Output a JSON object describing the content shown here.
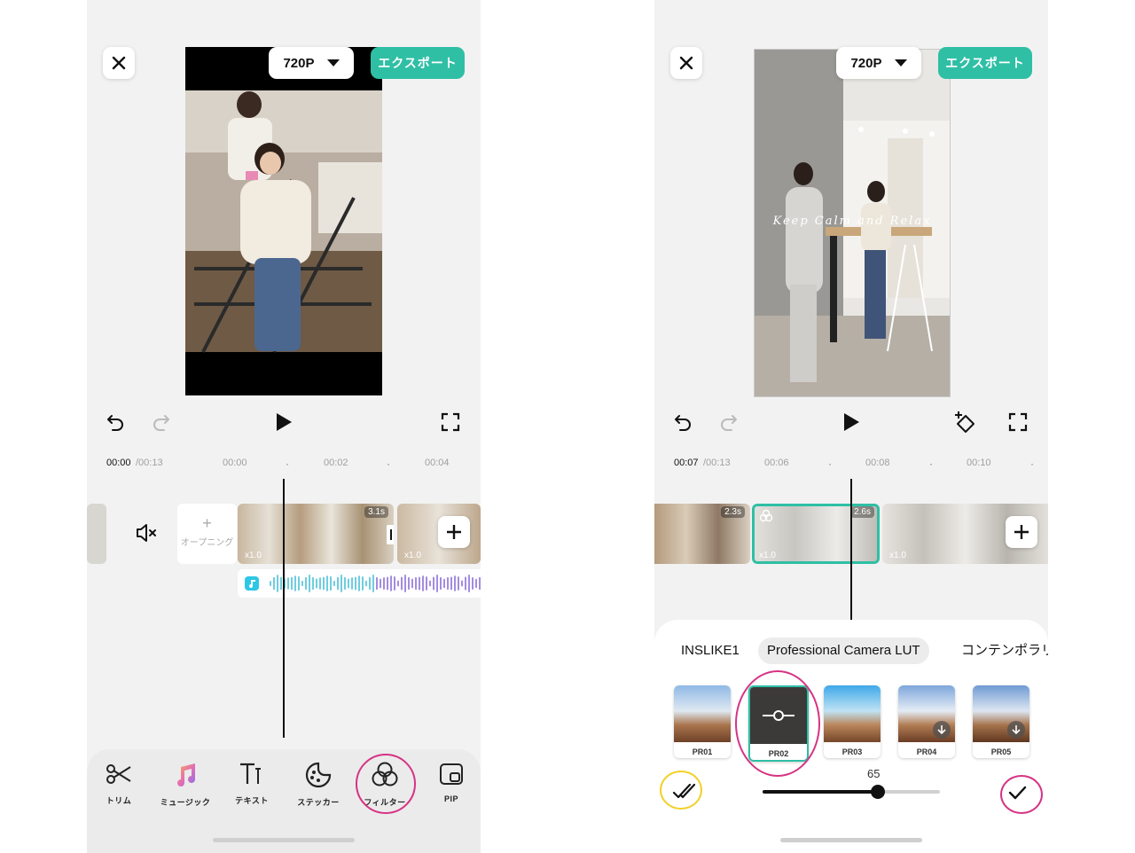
{
  "common": {
    "resolution": "720P",
    "export_label": "エクスポート",
    "accent_color": "#2fbfa5",
    "highlight_color": "#d63384",
    "highlight_color_2": "#f2d12b"
  },
  "left": {
    "time_current": "00:00",
    "time_total": "/00:13",
    "ticks": [
      "00:00",
      "00:02",
      "00:04"
    ],
    "opening_label": "オープニング",
    "clip_duration": "3.1s",
    "clip_speed": "x1.0",
    "clip2_speed": "x1.0",
    "toolbar": [
      {
        "label": "トリム",
        "icon": "scissors-icon"
      },
      {
        "label": "ミュージック",
        "icon": "music-note-icon"
      },
      {
        "label": "テキスト",
        "icon": "text-icon"
      },
      {
        "label": "ステッカー",
        "icon": "sticker-icon"
      },
      {
        "label": "フィルター",
        "icon": "filter-icon"
      },
      {
        "label": "PIP",
        "icon": "pip-icon"
      }
    ]
  },
  "right": {
    "time_current": "00:07",
    "time_total": "/00:13",
    "ticks": [
      "00:06",
      "00:08",
      "00:10"
    ],
    "video_caption": "Keep Calm and Relax",
    "clip1_duration": "2.3s",
    "clip2_duration": "2.6s",
    "clip2_speed": "x1.0",
    "clip3_speed": "x1.0",
    "categories": [
      "INSLIKE1",
      "Professional Camera LUT",
      "コンテンポラリ"
    ],
    "filters": [
      "PR01",
      "PR02",
      "PR03",
      "PR04",
      "PR05"
    ],
    "intensity_value": "65",
    "intensity": 0.65
  }
}
